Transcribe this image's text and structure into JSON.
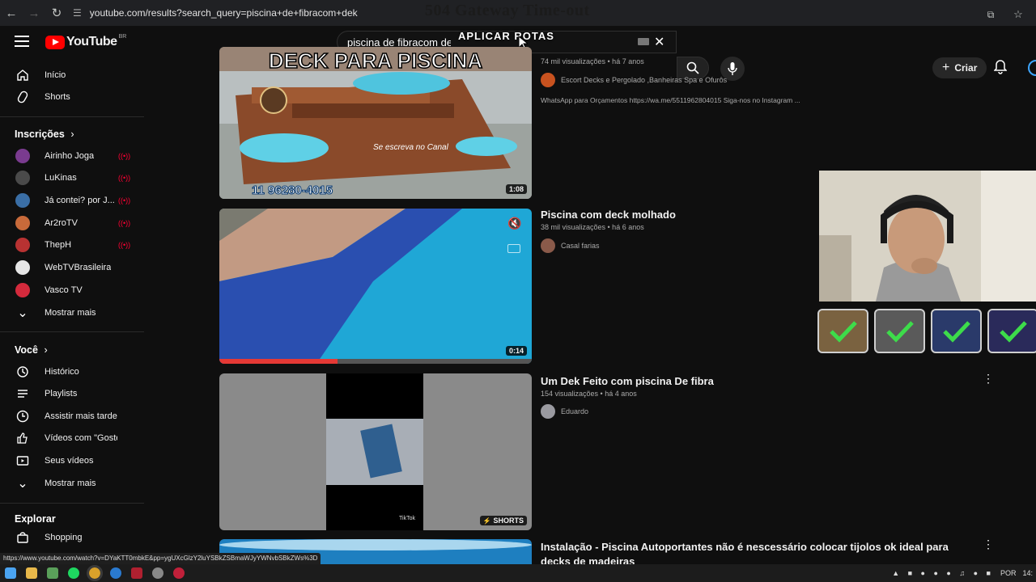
{
  "browser": {
    "url": "youtube.com/results?search_query=piscina+de+fibracom+dek",
    "overlay_error": "504 Gateway Time-out",
    "status_url": "https://www.youtube.com/watch?v=DYaKTT0mbkE&pp=ygUXcGlzY2luYSBkZSBmaWJyYWNvbSBkZWs%3D"
  },
  "header": {
    "logo_text": "YouTube",
    "logo_country": "BR",
    "search_value": "piscina de fibracom dek",
    "overlay_text": "APLICAR ROTAS",
    "create_label": "Criar"
  },
  "sidebar": {
    "main": [
      {
        "label": "Início",
        "icon": "home-icon"
      },
      {
        "label": "Shorts",
        "icon": "shorts-icon"
      }
    ],
    "subs_heading": "Inscrições",
    "subscriptions": [
      {
        "label": "Airinho Joga",
        "color": "#7a3b8f"
      },
      {
        "label": "LuKinas",
        "color": "#4a4a4a"
      },
      {
        "label": "Já contei? por J...",
        "color": "#3a6ea5"
      },
      {
        "label": "Ar2roTV",
        "color": "#c86a3a"
      },
      {
        "label": "ThepH",
        "color": "#b83232"
      },
      {
        "label": "WebTVBrasileira",
        "color": "#e6e6e6"
      },
      {
        "label": "Vasco TV",
        "color": "#d42a3c"
      }
    ],
    "subs_more": "Mostrar mais",
    "you_heading": "Você",
    "you": [
      {
        "label": "Histórico",
        "icon": "history-icon"
      },
      {
        "label": "Playlists",
        "icon": "playlists-icon"
      },
      {
        "label": "Assistir mais tarde",
        "icon": "watch-later-icon"
      },
      {
        "label": "Vídeos com \"Gostei\"",
        "icon": "thumbs-up-icon"
      },
      {
        "label": "Seus vídeos",
        "icon": "your-videos-icon"
      }
    ],
    "you_more": "Mostrar mais",
    "explore_heading": "Explorar",
    "explore": [
      {
        "label": "Shopping",
        "icon": "shopping-icon"
      }
    ]
  },
  "results": [
    {
      "thumb_text": "DECK PARA PISCINA",
      "thumb_phone": "11 96280-4015",
      "thumb_sub": "Se escreva no Canal",
      "duration": "1:08",
      "meta": "74 mil visualizações • há 7 anos",
      "channel": "Escort Decks e Pergolado ,Banheiras Spa e Ofurôs",
      "desc": "WhatsApp para Orçamentos https://wa.me/5511962804015 Siga-nos no Instagram ..."
    },
    {
      "title": "Piscina com deck molhado",
      "duration": "0:14",
      "meta": "38 mil visualizações • há 6 anos",
      "channel": "Casal farias"
    },
    {
      "title": "Um Dek Feito com piscina De fibra",
      "badge": "SHORTS",
      "meta": "154 visualizações • há 4 anos",
      "channel": "Eduardo",
      "thumb_watermark": "TikTok"
    },
    {
      "title_line1": "Instalação - Piscina Autoportantes não é nescessário colocar tijolos ok ideal para",
      "title_line2": "decks de madeiras"
    }
  ],
  "taskbar": {
    "lang": "POR",
    "time": "14:"
  },
  "colors": {
    "bg": "#0f0f0f",
    "accent_red": "#ff0000",
    "check_green": "#3ddc4a"
  }
}
